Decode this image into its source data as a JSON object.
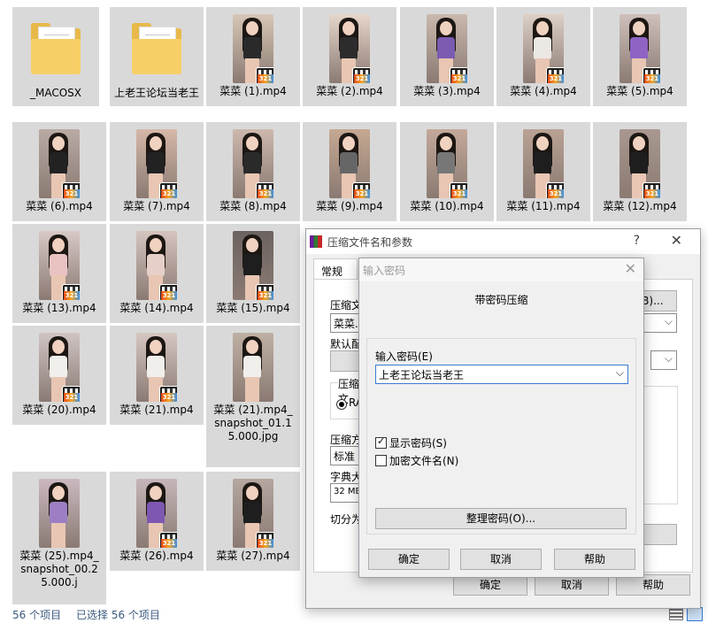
{
  "explorer": {
    "items": [
      {
        "label": "_MACOSX",
        "kind": "folder"
      },
      {
        "label": "上老王论坛当老王",
        "kind": "folder"
      },
      {
        "label": "菜菜 (1).mp4",
        "kind": "video"
      },
      {
        "label": "菜菜 (2).mp4",
        "kind": "video"
      },
      {
        "label": "菜菜 (3).mp4",
        "kind": "video"
      },
      {
        "label": "菜菜 (4).mp4",
        "kind": "video"
      },
      {
        "label": "菜菜 (5).mp4",
        "kind": "video"
      },
      {
        "label": "菜菜 (6).mp4",
        "kind": "video"
      },
      {
        "label": "菜菜 (7).mp4",
        "kind": "video"
      },
      {
        "label": "菜菜 (8).mp4",
        "kind": "video"
      },
      {
        "label": "菜菜 (9).mp4",
        "kind": "video"
      },
      {
        "label": "菜菜 (10).mp4",
        "kind": "video"
      },
      {
        "label": "菜菜 (11).mp4",
        "kind": "video"
      },
      {
        "label": "菜菜 (12).mp4",
        "kind": "video"
      },
      {
        "label": "菜菜 (13).mp4",
        "kind": "video"
      },
      {
        "label": "菜菜 (14).mp4",
        "kind": "video"
      },
      {
        "label": "菜菜 (15).mp4",
        "kind": "video"
      },
      {
        "label": "菜菜 (20).mp4",
        "kind": "video"
      },
      {
        "label": "菜菜 (21).mp4",
        "kind": "video"
      },
      {
        "label": "菜菜 (21).mp4_snapshot_01.15.000.jpg",
        "kind": "image"
      },
      {
        "label": "菜菜 (25).mp4_snapshot_00.25.000.j",
        "kind": "image"
      },
      {
        "label": "菜菜 (26).mp4",
        "kind": "video"
      },
      {
        "label": "菜菜 (27).mp4",
        "kind": "video"
      }
    ]
  },
  "status": {
    "count": "56 个项目",
    "selected": "已选择 56 个项目"
  },
  "archive_dialog": {
    "title": "压缩文件名和参数",
    "help_glyph": "?",
    "close_glyph": "✕",
    "tab_general": "常规",
    "archive_name_label": "压缩文",
    "archive_name_value": "菜菜.r",
    "default_config_label": "默认配",
    "browse_label": "(B)...",
    "format_label": "压缩文",
    "format_radio": "RA",
    "method_label": "压缩方",
    "method_value": "标准",
    "dict_label": "字典大",
    "dict_value": "32 MB",
    "split_label": "切分为",
    "ok": "确定",
    "cancel": "取消",
    "help": "帮助"
  },
  "password_dialog": {
    "title": "输入密码",
    "close_glyph": "✕",
    "heading": "带密码压缩",
    "password_label": "输入密码(E)",
    "password_value": "上老王论坛当老王",
    "show_password": "显示密码(S)",
    "show_password_checked": true,
    "encrypt_names": "加密文件名(N)",
    "encrypt_names_checked": false,
    "organize": "整理密码(O)...",
    "ok": "确定",
    "cancel": "取消",
    "help": "帮助"
  },
  "colors": {
    "selection": "#d9d9d9",
    "status_text": "#3c5a80",
    "focus": "#3a7bd5"
  }
}
